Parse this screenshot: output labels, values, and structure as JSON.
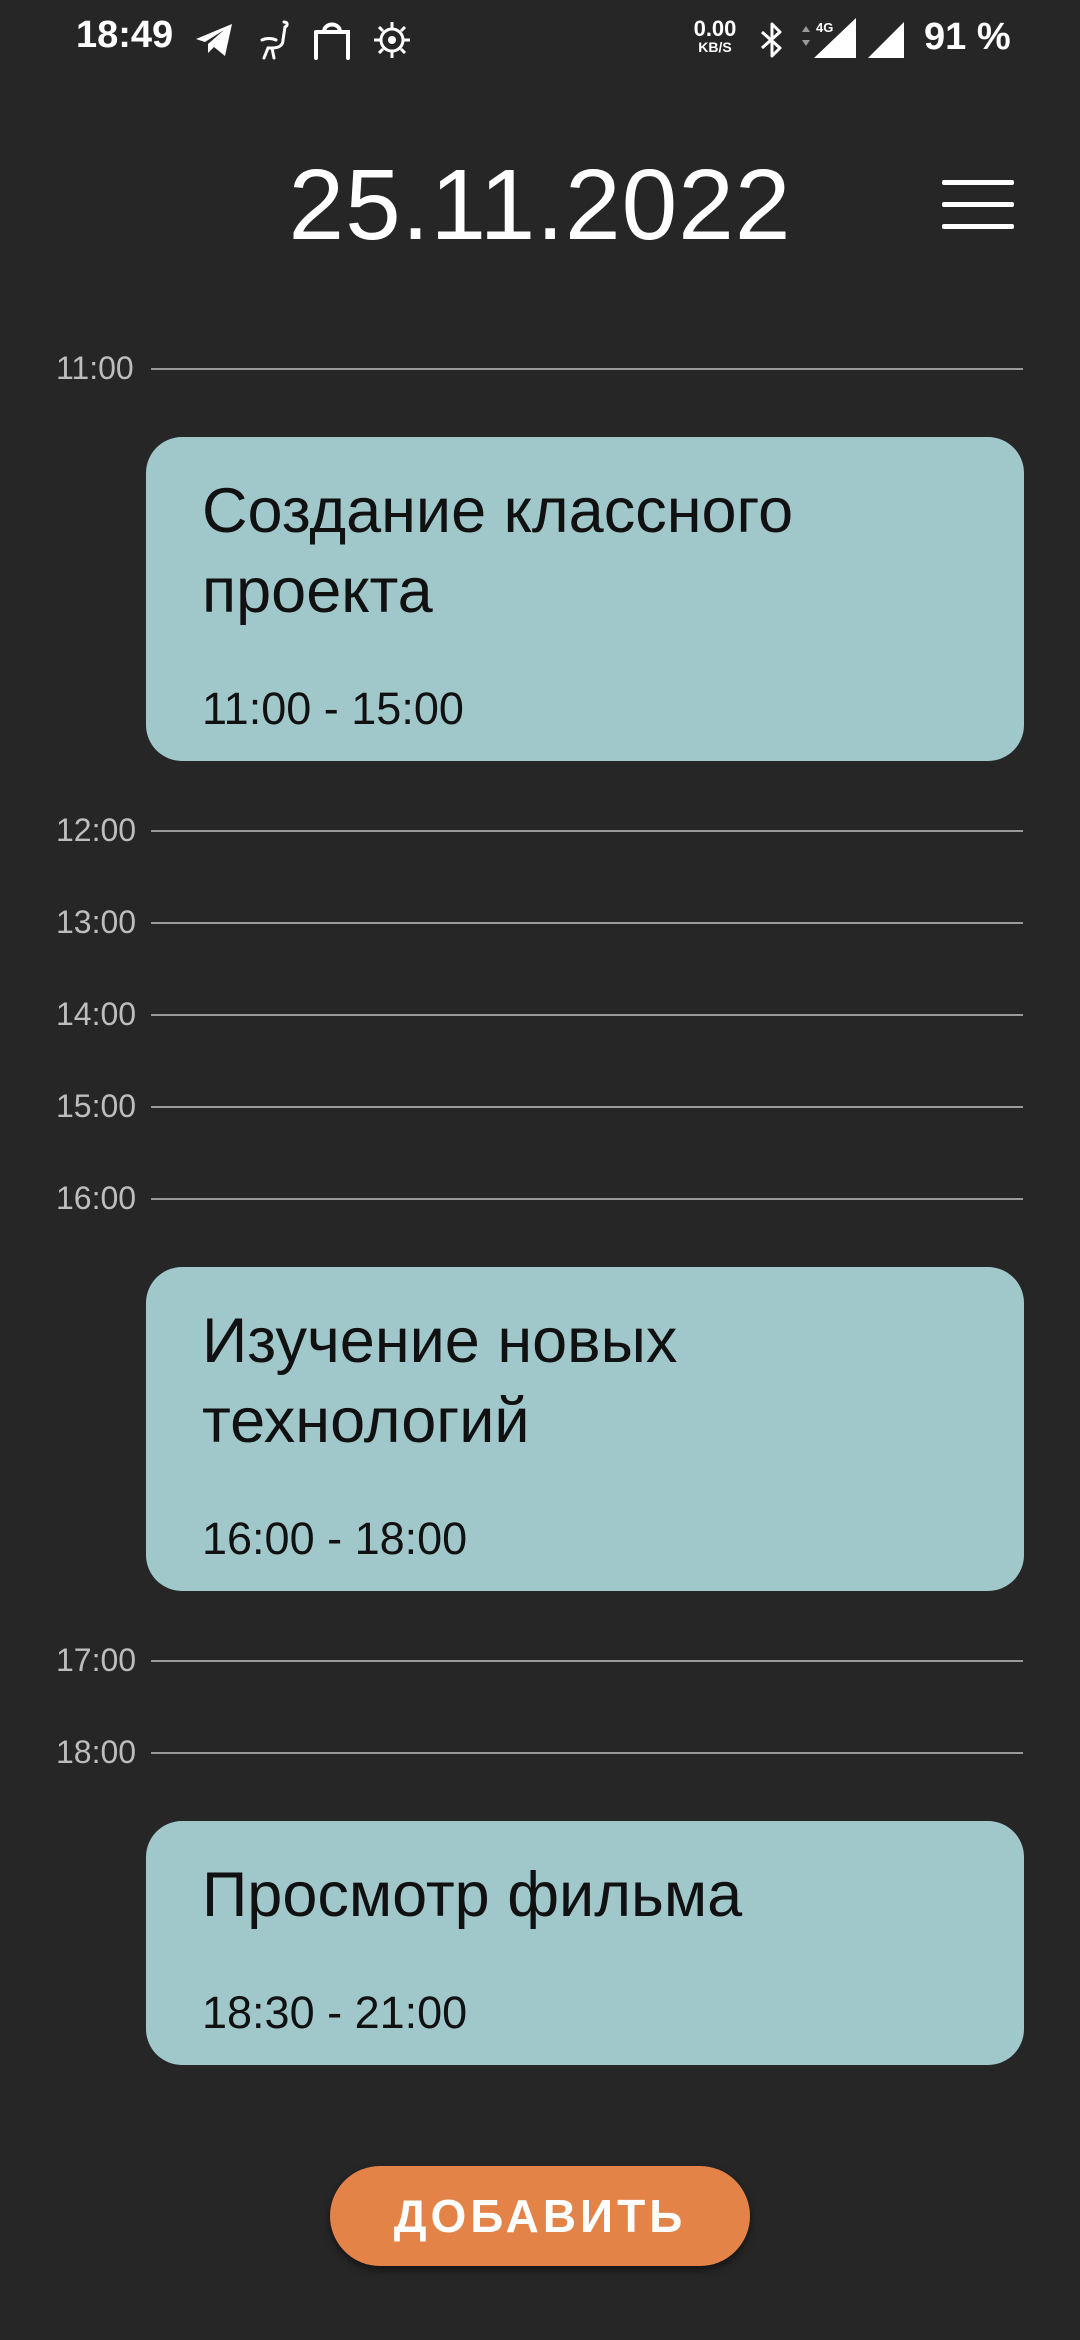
{
  "status_bar": {
    "time": "18:49",
    "icons": [
      "telegram-icon",
      "ostrich-icon",
      "shopping-bag-icon",
      "gear-bug-icon"
    ],
    "net_speed_value": "0.00",
    "net_speed_unit": "KB/S",
    "network_type": "4G",
    "battery": "91 %"
  },
  "header": {
    "date": "25.11.2022",
    "menu_icon": "hamburger-menu-icon"
  },
  "timeline": {
    "hours": [
      "11:00",
      "12:00",
      "13:00",
      "14:00",
      "15:00",
      "16:00",
      "17:00",
      "18:00"
    ]
  },
  "events": [
    {
      "title": "Создание классного проекта",
      "time": "11:00 - 15:00"
    },
    {
      "title": "Изучение новых технологий",
      "time": "16:00 - 18:00"
    },
    {
      "title": "Просмотр фильма",
      "time": "18:30 - 21:00"
    }
  ],
  "actions": {
    "add_label": "ДОБАВИТЬ"
  },
  "colors": {
    "background": "#262626",
    "card": "#a0c8cb",
    "accent": "#e48348",
    "grid_line": "#9a9a9a"
  }
}
